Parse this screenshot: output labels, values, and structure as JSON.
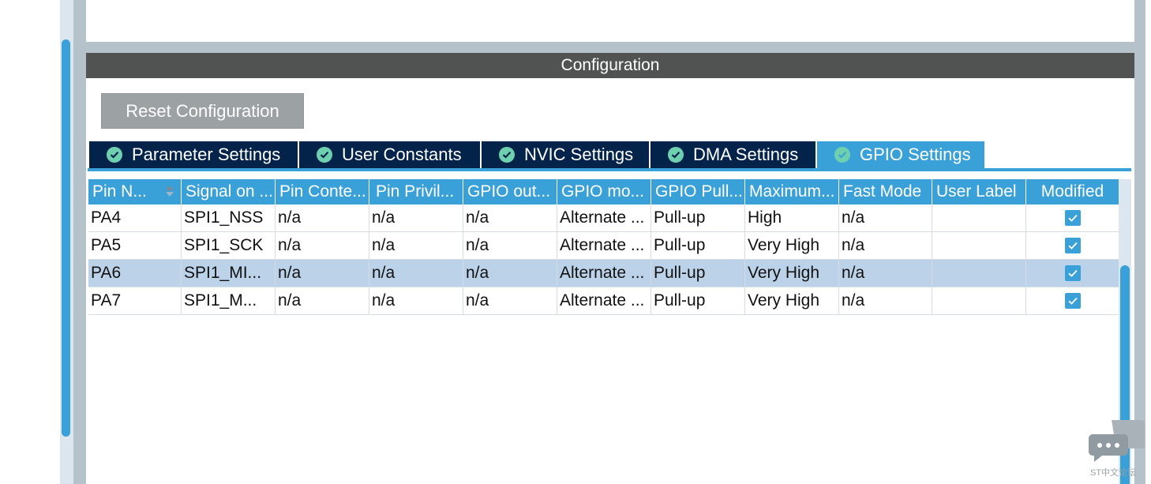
{
  "config_header": "Configuration",
  "reset_button": "Reset Configuration",
  "tabs": [
    {
      "label": "Parameter Settings",
      "active": false
    },
    {
      "label": "User Constants",
      "active": false
    },
    {
      "label": "NVIC Settings",
      "active": false
    },
    {
      "label": "DMA Settings",
      "active": false
    },
    {
      "label": "GPIO Settings",
      "active": true
    }
  ],
  "table": {
    "columns": [
      "Pin N...",
      "Signal on ...",
      "Pin Conte...",
      "Pin Privil...",
      "GPIO out...",
      "GPIO mo...",
      "GPIO Pull...",
      "Maximum...",
      "Fast Mode",
      "User Label",
      "Modified"
    ],
    "rows": [
      {
        "pin": "PA4",
        "signal": "SPI1_NSS",
        "context": "n/a",
        "privilege": "n/a",
        "output": "n/a",
        "mode": "Alternate ...",
        "pull": "Pull-up",
        "max_speed": "High",
        "fast_mode": "n/a",
        "user_label": "",
        "modified": true,
        "selected": false
      },
      {
        "pin": "PA5",
        "signal": "SPI1_SCK",
        "context": "n/a",
        "privilege": "n/a",
        "output": "n/a",
        "mode": "Alternate ...",
        "pull": "Pull-up",
        "max_speed": "Very High",
        "fast_mode": "n/a",
        "user_label": "",
        "modified": true,
        "selected": false
      },
      {
        "pin": "PA6",
        "signal": "SPI1_MI...",
        "context": "n/a",
        "privilege": "n/a",
        "output": "n/a",
        "mode": "Alternate ...",
        "pull": "Pull-up",
        "max_speed": "Very High",
        "fast_mode": "n/a",
        "user_label": "",
        "modified": true,
        "selected": true
      },
      {
        "pin": "PA7",
        "signal": "SPI1_M...",
        "context": "n/a",
        "privilege": "n/a",
        "output": "n/a",
        "mode": "Alternate ...",
        "pull": "Pull-up",
        "max_speed": "Very High",
        "fast_mode": "n/a",
        "user_label": "",
        "modified": true,
        "selected": false
      }
    ]
  },
  "watermark": "ST中文论坛",
  "colors": {
    "accent": "#3aa0d8",
    "tab_dark": "#03234b",
    "header_dark": "#505352",
    "selected_row": "#bcd2e8",
    "check_green": "#6fd0b0"
  },
  "icons": {
    "tab_status": "check-circle-icon",
    "sort": "sort-icon",
    "modified": "checkbox-checked-icon",
    "chat": "chat-bubble-icon"
  }
}
